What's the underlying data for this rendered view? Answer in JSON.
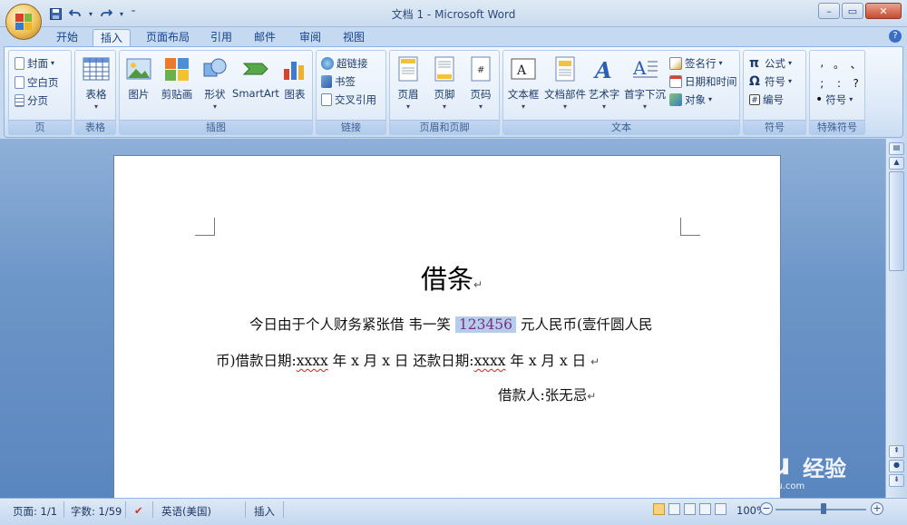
{
  "window": {
    "title": "文档 1 - Microsoft Word",
    "controls": [
      "–",
      "▭",
      "✕"
    ]
  },
  "tabs": [
    "开始",
    "插入",
    "页面布局",
    "引用",
    "邮件",
    "审阅",
    "视图"
  ],
  "active_tab": "插入",
  "ribbon": {
    "page_group": {
      "label": "页",
      "items": [
        "封面",
        "空白页",
        "分页"
      ]
    },
    "table_group": {
      "label": "表格",
      "button": "表格"
    },
    "illus_group": {
      "label": "插图",
      "buttons": [
        "图片",
        "剪贴画",
        "形状",
        "SmartArt",
        "图表"
      ]
    },
    "link_group": {
      "label": "链接",
      "items": [
        "超链接",
        "书签",
        "交叉引用"
      ]
    },
    "hf_group": {
      "label": "页眉和页脚",
      "buttons": [
        "页眉",
        "页脚",
        "页码"
      ]
    },
    "text_group": {
      "label": "文本",
      "buttons": [
        "文本框",
        "文档部件",
        "艺术字",
        "首字下沉"
      ],
      "items": [
        "签名行",
        "日期和时间",
        "对象"
      ]
    },
    "symbol_group": {
      "label": "符号",
      "items": [
        "公式",
        "符号",
        "编号"
      ]
    },
    "special_group": {
      "label": "特殊符号",
      "chars": [
        ",",
        "。",
        "、",
        ";",
        ":",
        "?"
      ],
      "button": "符号"
    }
  },
  "document": {
    "title": "借条",
    "line1_before": "今日由于个人财务紧张借 韦一笑 ",
    "line1_selected": "123456",
    "line1_after": " 元人民币(壹仟圆人民",
    "line2_a": "币)借款日期:",
    "line2_x1": "xxxx",
    "line2_b": " 年 x 月 x 日 还款日期:",
    "line2_x2": "xxxx",
    "line2_c": " 年 x 月 x 日 ",
    "line3": "借款人:张无忌",
    "para_mark": "↵"
  },
  "status": {
    "page": "页面: 1/1",
    "words": "字数: 1/59",
    "language": "英语(美国)",
    "mode": "插入",
    "zoom": "100%"
  },
  "watermark": {
    "brand": "Baidu",
    "jy": "经验",
    "url": "jingyan.baidu.com"
  }
}
